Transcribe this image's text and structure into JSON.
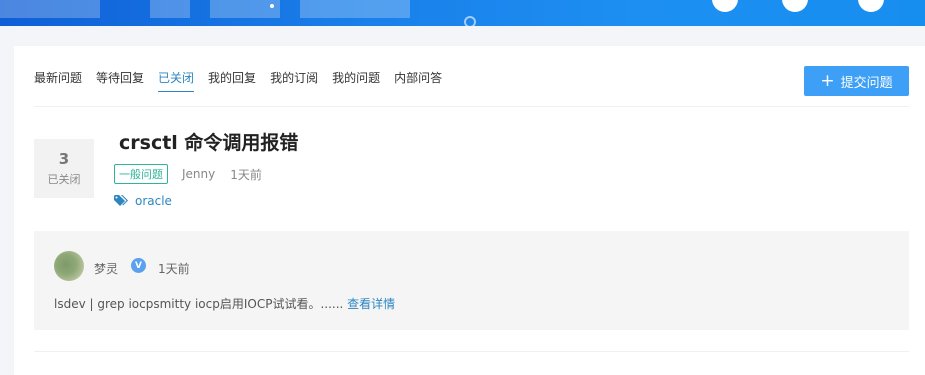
{
  "tabs": [
    {
      "label": "最新问题"
    },
    {
      "label": "等待回复"
    },
    {
      "label": "已关闭"
    },
    {
      "label": "我的回复"
    },
    {
      "label": "我的订阅"
    },
    {
      "label": "我的问题"
    },
    {
      "label": "内部问答"
    }
  ],
  "active_tab": "已关闭",
  "ask_button": {
    "label": "提交问题",
    "icon": "plus-icon"
  },
  "question": {
    "answer_count": "3",
    "status": "已关闭",
    "title": "crsctl 命令调用报错",
    "category": "一般问题",
    "author": "Jenny",
    "time": "1天前",
    "tag": "oracle",
    "tag_icon": "tags-icon"
  },
  "answer": {
    "user": "梦灵",
    "verified_badge": "V",
    "time": "1天前",
    "text": "lsdev | grep iocpsmitty iocp启用IOCP试试看。......",
    "more_link": "查看详情"
  },
  "colors": {
    "accent": "#2e86c1",
    "button": "#3d9ff5",
    "category": "#2fb49a",
    "banner": "#1a80ea"
  }
}
